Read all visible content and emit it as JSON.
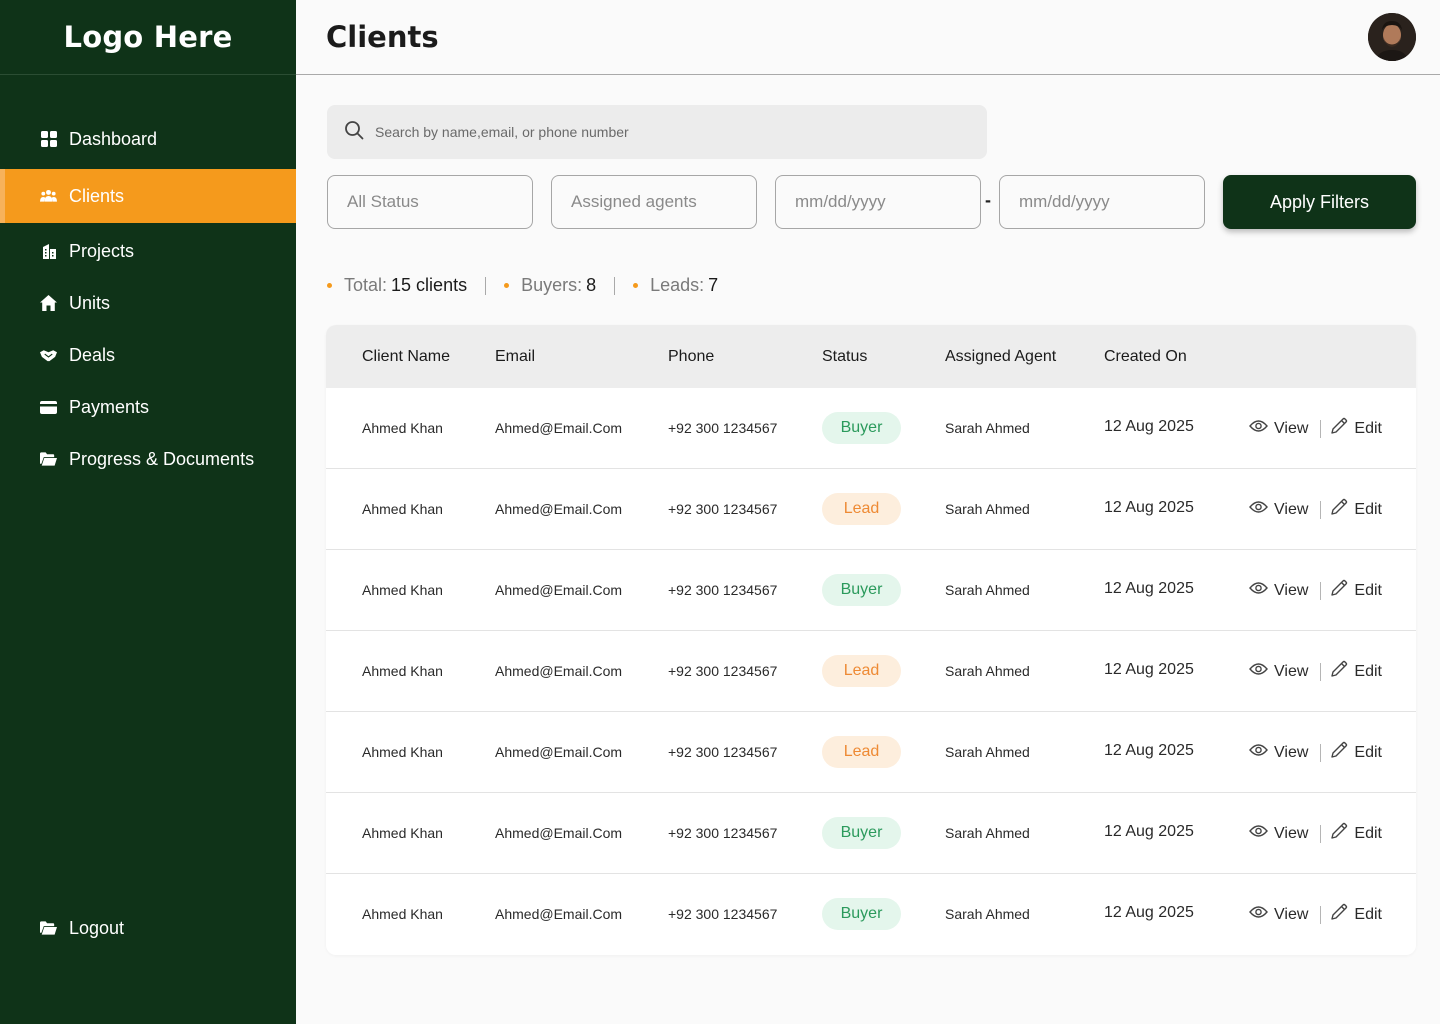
{
  "sidebar": {
    "logo": "Logo Here",
    "items": [
      {
        "label": "Dashboard",
        "icon": "grid-icon"
      },
      {
        "label": "Clients",
        "icon": "users-icon",
        "active": true
      },
      {
        "label": "Projects",
        "icon": "building-icon"
      },
      {
        "label": "Units",
        "icon": "home-icon"
      },
      {
        "label": "Deals",
        "icon": "handshake-icon"
      },
      {
        "label": "Payments",
        "icon": "credit-card-icon"
      },
      {
        "label": "Progress & Documents",
        "icon": "folder-open-icon"
      }
    ],
    "logout": {
      "label": "Logout",
      "icon": "folder-open-icon"
    }
  },
  "header": {
    "title": "Clients"
  },
  "search": {
    "placeholder": "Search by name,email, or phone number"
  },
  "filters": {
    "status": "All Status",
    "agents": "Assigned agents",
    "date_from": "mm/dd/yyyy",
    "date_separator": "-",
    "date_to": "mm/dd/yyyy",
    "apply_label": "Apply Filters"
  },
  "summary": {
    "total_label": "Total:",
    "total_value": "15 clients",
    "buyers_label": "Buyers:",
    "buyers_value": "8",
    "leads_label": "Leads:",
    "leads_value": "7"
  },
  "table": {
    "columns": [
      "Client Name",
      "Email",
      "Phone",
      "Status",
      "Assigned Agent",
      "Created On"
    ],
    "view_label": "View",
    "edit_label": "Edit",
    "rows": [
      {
        "name": "Ahmed Khan",
        "email": "Ahmed@Email.Com",
        "phone": "+92 300 1234567",
        "status": "Buyer",
        "agent": "Sarah Ahmed",
        "created": "12 Aug 2025"
      },
      {
        "name": "Ahmed Khan",
        "email": "Ahmed@Email.Com",
        "phone": "+92 300 1234567",
        "status": "Lead",
        "agent": "Sarah Ahmed",
        "created": "12 Aug 2025"
      },
      {
        "name": "Ahmed Khan",
        "email": "Ahmed@Email.Com",
        "phone": "+92 300 1234567",
        "status": "Buyer",
        "agent": "Sarah Ahmed",
        "created": "12 Aug 2025"
      },
      {
        "name": "Ahmed Khan",
        "email": "Ahmed@Email.Com",
        "phone": "+92 300 1234567",
        "status": "Lead",
        "agent": "Sarah Ahmed",
        "created": "12 Aug 2025"
      },
      {
        "name": "Ahmed Khan",
        "email": "Ahmed@Email.Com",
        "phone": "+92 300 1234567",
        "status": "Lead",
        "agent": "Sarah Ahmed",
        "created": "12 Aug 2025"
      },
      {
        "name": "Ahmed Khan",
        "email": "Ahmed@Email.Com",
        "phone": "+92 300 1234567",
        "status": "Buyer",
        "agent": "Sarah Ahmed",
        "created": "12 Aug 2025"
      },
      {
        "name": "Ahmed Khan",
        "email": "Ahmed@Email.Com",
        "phone": "+92 300 1234567",
        "status": "Buyer",
        "agent": "Sarah Ahmed",
        "created": "12 Aug 2025"
      }
    ]
  },
  "colors": {
    "sidebar_bg": "#0f3318",
    "accent": "#f59a1c",
    "buyer_bg": "#e4f6ec",
    "buyer_text": "#2b9a5c",
    "lead_bg": "#fdeedd",
    "lead_text": "#ee8a34"
  }
}
